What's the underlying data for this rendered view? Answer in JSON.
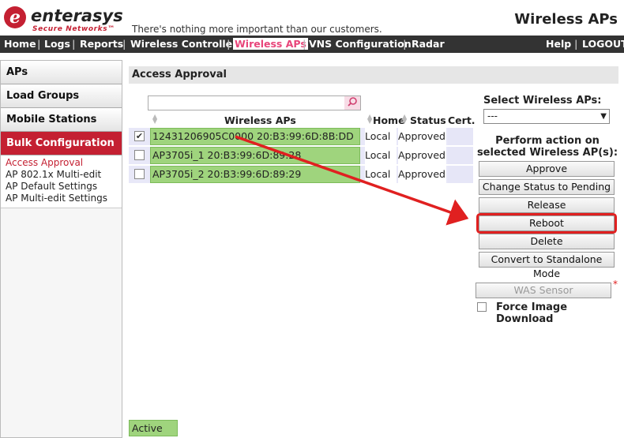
{
  "header": {
    "logo_name": "enterasys",
    "logo_subtitle": "Secure Networks™",
    "tagline": "There's nothing more important than our customers.",
    "page_title": "Wireless APs"
  },
  "nav": {
    "left": [
      "Home",
      "Logs",
      "Reports",
      "Wireless Controller",
      "Wireless APs",
      "VNS Configuration",
      "Radar"
    ],
    "active": "Wireless APs",
    "right": [
      "Help",
      "LOGOUT"
    ]
  },
  "sidebar": {
    "tabs": [
      "APs",
      "Load Groups",
      "Mobile Stations",
      "Bulk Configuration"
    ],
    "selected_tab": "Bulk Configuration",
    "subitems": [
      "Access Approval",
      "AP 802.1x Multi-edit",
      "AP Default Settings",
      "AP Multi-edit Settings"
    ],
    "active_subitem": "Access Approval"
  },
  "main": {
    "section_title": "Access Approval",
    "search": {
      "value": ""
    },
    "columns": [
      "Wireless APs",
      "Home",
      "Status",
      "Cert."
    ],
    "rows": [
      {
        "ap": "12431206905C0000 20:B3:99:6D:8B:DD",
        "home": "Local",
        "status": "Approved",
        "checked": true
      },
      {
        "ap": "AP3705i_1 20:B3:99:6D:89:28",
        "home": "Local",
        "status": "Approved",
        "checked": false
      },
      {
        "ap": "AP3705i_2 20:B3:99:6D:89:29",
        "home": "Local",
        "status": "Approved",
        "checked": false
      }
    ],
    "legend_active": "Active AP"
  },
  "right_panel": {
    "select_label": "Select Wireless APs:",
    "select_value": "---",
    "perform_label": "Perform action on selected Wireless AP(s):",
    "buttons": [
      "Approve",
      "Change Status to Pending",
      "Release",
      "Reboot",
      "Delete",
      "Convert to Standalone Mode"
    ],
    "highlighted_button": "Reboot",
    "was_sensor": "WAS Sensor",
    "required_mark": "*",
    "force_download_label": "Force Image Download"
  },
  "colors": {
    "brand_red": "#c42032",
    "nav_bg": "#333333",
    "active_ap_green": "#9fd47d",
    "annotation_red": "#e02020"
  }
}
